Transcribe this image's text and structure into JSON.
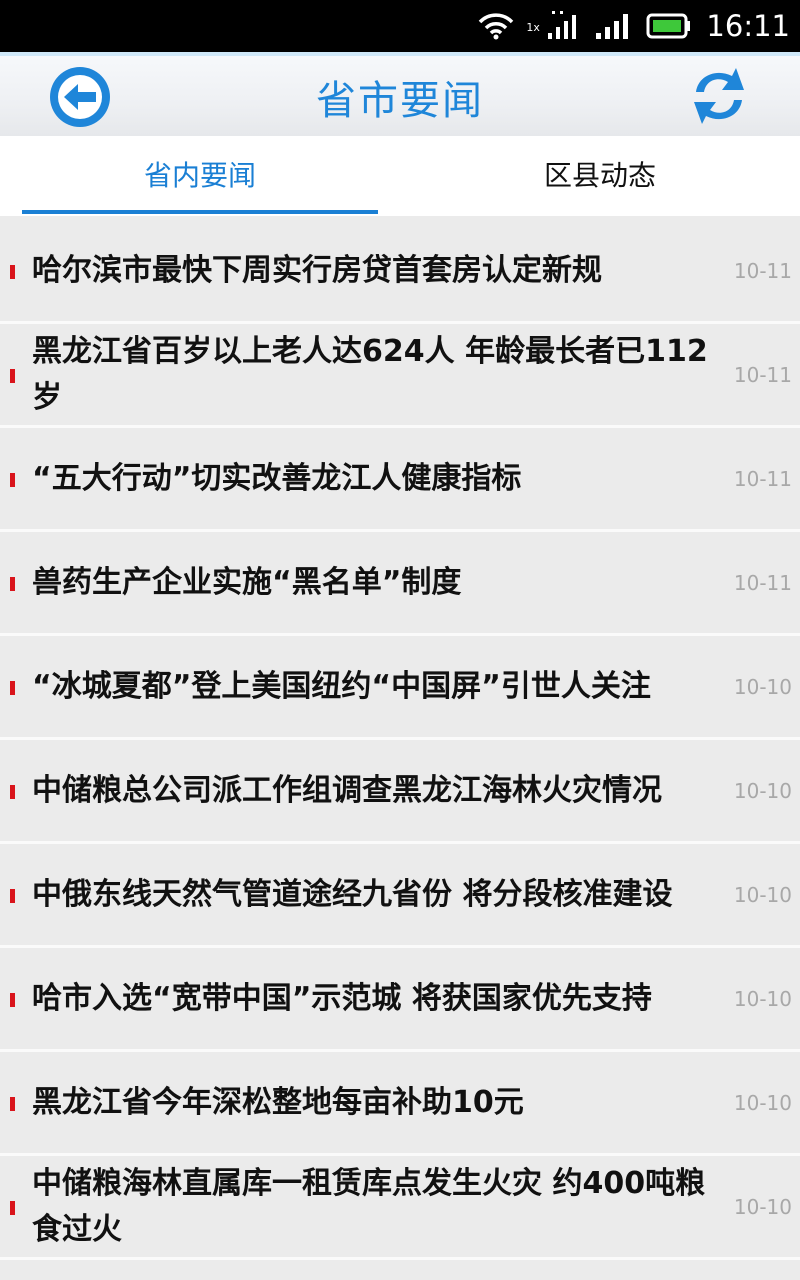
{
  "status_bar": {
    "time": "16:11",
    "network_type": "1x",
    "icons": [
      "wifi-icon",
      "data-signal-icon",
      "cell-signal-icon",
      "battery-icon"
    ]
  },
  "header": {
    "title": "省市要闻",
    "back_icon": "back-arrow-icon",
    "refresh_icon": "refresh-icon",
    "accent_color": "#1f86d9"
  },
  "tabs": [
    {
      "label": "省内要闻",
      "selected": true
    },
    {
      "label": "区县动态",
      "selected": false
    }
  ],
  "news": [
    {
      "title": "哈尔滨市最快下周实行房贷首套房认定新规",
      "date": "10-11"
    },
    {
      "title": "黑龙江省百岁以上老人达624人 年龄最长者已112岁",
      "date": "10-11"
    },
    {
      "title": "“五大行动”切实改善龙江人健康指标",
      "date": "10-11"
    },
    {
      "title": "兽药生产企业实施“黑名单”制度",
      "date": "10-11"
    },
    {
      "title": "“冰城夏都”登上美国纽约“中国屏”引世人关注",
      "date": "10-10"
    },
    {
      "title": "中储粮总公司派工作组调查黑龙江海林火灾情况",
      "date": "10-10"
    },
    {
      "title": "中俄东线天然气管道途经九省份 将分段核准建设",
      "date": "10-10"
    },
    {
      "title": "哈市入选“宽带中国”示范城 将获国家优先支持",
      "date": "10-10"
    },
    {
      "title": "黑龙江省今年深松整地每亩补助10元",
      "date": "10-10"
    },
    {
      "title": "中储粮海林直属库一租赁库点发生火灾 约400吨粮食过火",
      "date": "10-10"
    }
  ]
}
